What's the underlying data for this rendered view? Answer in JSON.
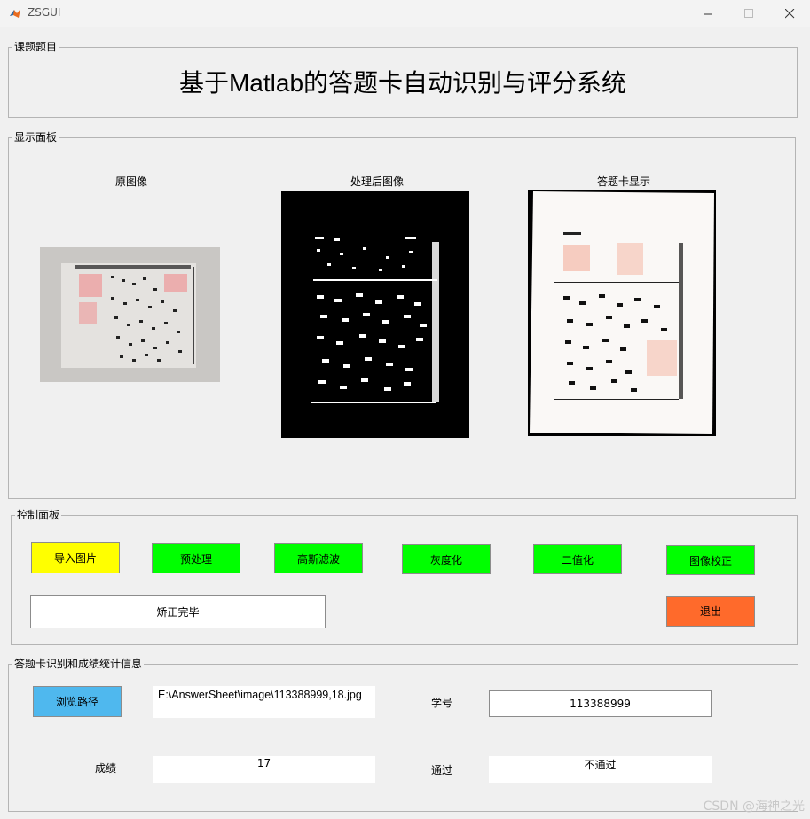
{
  "window": {
    "title": "ZSGUI"
  },
  "title_panel": {
    "label": "课题题目",
    "title": "基于Matlab的答题卡自动识别与评分系统"
  },
  "display_panel": {
    "label": "显示面板",
    "original_caption": "原图像",
    "processed_caption": "处理后图像",
    "sheet_caption": "答题卡显示"
  },
  "control_panel": {
    "label": "控制面板",
    "buttons": {
      "import": "导入图片",
      "preprocess": "预处理",
      "gaussian": "高斯滤波",
      "grayscale": "灰度化",
      "binarize": "二值化",
      "correct": "图像校正",
      "exit": "退出"
    },
    "status": "矫正完毕"
  },
  "result_panel": {
    "label": "答题卡识别和成绩统计信息",
    "browse_label": "浏览路径",
    "path_value": "E:\\AnswerSheet\\image\\113388999,18.jpg",
    "student_id_label": "学号",
    "student_id_value": "113388999",
    "score_label": "成绩",
    "score_value": "17",
    "pass_label": "通过",
    "pass_value": "不通过"
  },
  "watermark": "CSDN @海神之光",
  "colors": {
    "green_button": "#00ff00",
    "yellow_button": "#ffff00",
    "exit_button": "#ff6a2b",
    "browse_button": "#4fb8ee"
  }
}
